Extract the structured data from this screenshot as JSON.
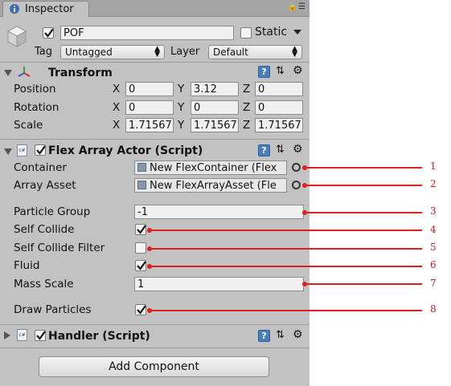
{
  "tab": {
    "label": "Inspector"
  },
  "header": {
    "name": "POF",
    "active": true,
    "static_label": "Static",
    "static_checked": false,
    "tag_label": "Tag",
    "tag_value": "Untagged",
    "layer_label": "Layer",
    "layer_value": "Default"
  },
  "transform": {
    "title": "Transform",
    "position": {
      "label": "Position",
      "x": "0",
      "y": "3.12",
      "z": "0"
    },
    "rotation": {
      "label": "Rotation",
      "x": "0",
      "y": "0",
      "z": "0"
    },
    "scale": {
      "label": "Scale",
      "x": "1.71567",
      "y": "1.71567",
      "z": "1.71567"
    },
    "axis_x": "X",
    "axis_y": "Y",
    "axis_z": "Z"
  },
  "flex": {
    "title": "Flex Array Actor (Script)",
    "enabled": true,
    "container_label": "Container",
    "container_value": "New FlexContainer (Flex",
    "asset_label": "Array Asset",
    "asset_value": "New FlexArrayAsset (Fle",
    "particle_group_label": "Particle Group",
    "particle_group_value": "-1",
    "self_collide_label": "Self Collide",
    "self_collide": true,
    "self_collide_filter_label": "Self Collide Filter",
    "self_collide_filter": false,
    "fluid_label": "Fluid",
    "fluid": true,
    "mass_scale_label": "Mass Scale",
    "mass_scale_value": "1",
    "draw_particles_label": "Draw Particles",
    "draw_particles": true
  },
  "handler": {
    "title": "Handler (Script)",
    "enabled": true
  },
  "add_component_label": "Add Component",
  "callouts": [
    "1",
    "2",
    "3",
    "4",
    "5",
    "6",
    "7",
    "8"
  ],
  "colors": {
    "panel": "#c2c2c2",
    "callout": "#dd1f1f",
    "book_icon": "#4a7fbf"
  }
}
